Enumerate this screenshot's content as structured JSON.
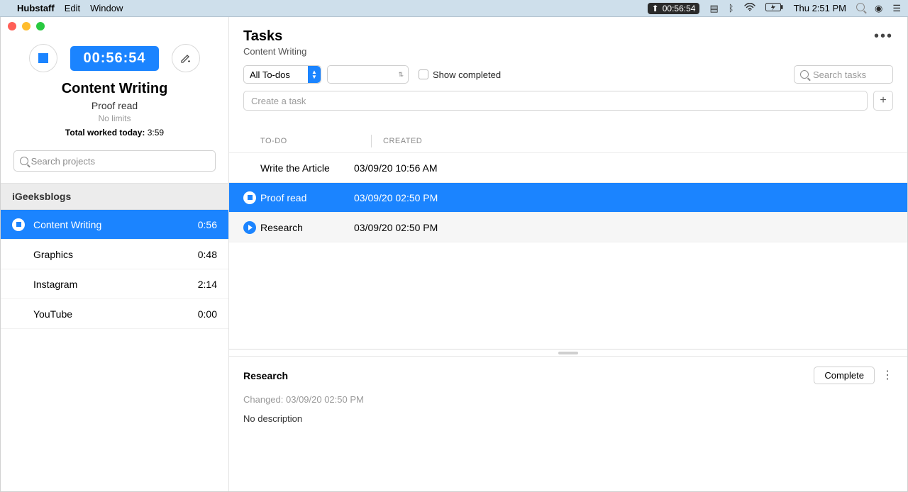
{
  "menubar": {
    "app": "Hubstaff",
    "menus": [
      "Edit",
      "Window"
    ],
    "chip_time": "00:56:54",
    "clock": "Thu 2:51 PM"
  },
  "sidebar": {
    "timer": "00:56:54",
    "project": "Content Writing",
    "task": "Proof read",
    "limits": "No limits",
    "total_lbl": "Total worked today:",
    "total_val": "3:59",
    "search_placeholder": "Search projects",
    "org": "iGeeksblogs",
    "projects": [
      {
        "name": "Content Writing",
        "time": "0:56",
        "active": true
      },
      {
        "name": "Graphics",
        "time": "0:48",
        "active": false
      },
      {
        "name": "Instagram",
        "time": "2:14",
        "active": false
      },
      {
        "name": "YouTube",
        "time": "0:00",
        "active": false
      }
    ]
  },
  "main": {
    "title": "Tasks",
    "subtitle": "Content Writing",
    "filter_label": "All To-dos",
    "show_completed": "Show completed",
    "search_placeholder": "Search tasks",
    "create_placeholder": "Create a task",
    "cols": {
      "a": "TO-DO",
      "b": "CREATED"
    },
    "rows": [
      {
        "name": "Write the Article",
        "created": "03/09/20 10:56 AM",
        "state": "none"
      },
      {
        "name": "Proof read",
        "created": "03/09/20 02:50 PM",
        "state": "active"
      },
      {
        "name": "Research",
        "created": "03/09/20 02:50 PM",
        "state": "idle"
      }
    ],
    "detail": {
      "title": "Research",
      "complete": "Complete",
      "changed": "Changed: 03/09/20 02:50 PM",
      "desc": "No description"
    }
  }
}
